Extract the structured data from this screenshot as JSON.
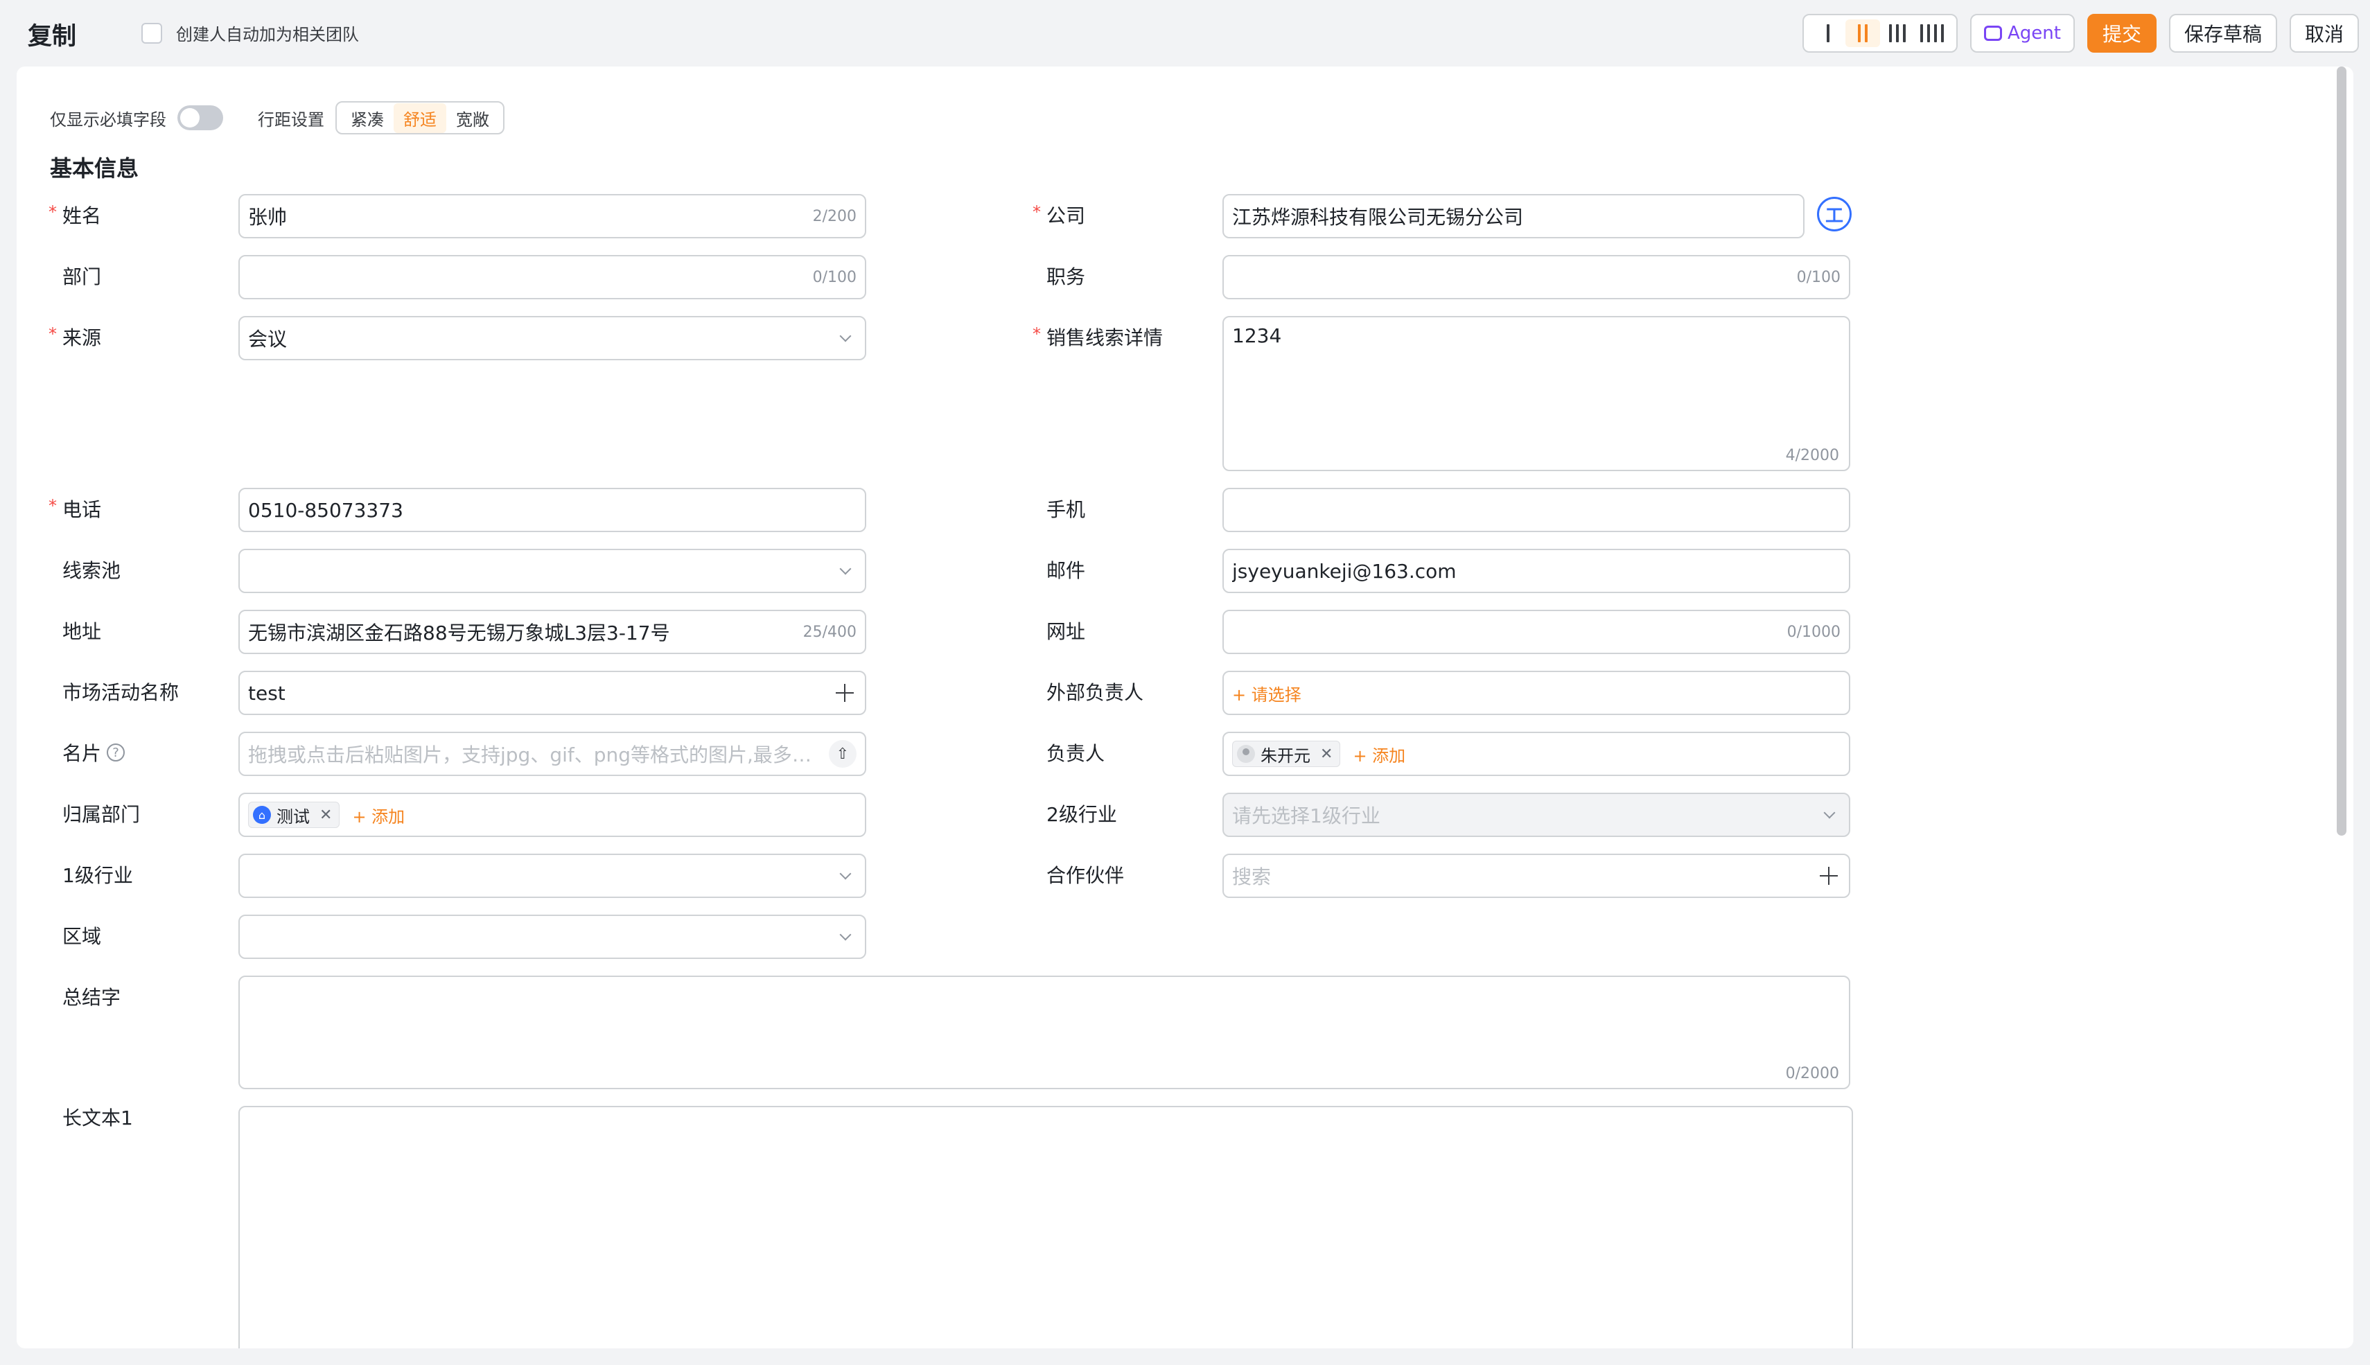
{
  "header": {
    "title": "复制",
    "auto_team_label": "创建人自动加为相关团队",
    "agent_label": "Agent",
    "submit_label": "提交",
    "save_draft_label": "保存草稿",
    "cancel_label": "取消"
  },
  "toolbar": {
    "required_only_label": "仅显示必填字段",
    "row_spacing_label": "行距设置",
    "spacing_options": [
      "紧凑",
      "舒适",
      "宽敞"
    ],
    "spacing_selected": "舒适"
  },
  "section": {
    "title": "基本信息"
  },
  "fields": {
    "name": {
      "label": "姓名",
      "value": "张帅",
      "count": "2/200"
    },
    "company": {
      "label": "公司",
      "value": "江苏烨源科技有限公司无锡分公司",
      "icon_text": "工"
    },
    "department": {
      "label": "部门",
      "value": "",
      "count": "0/100"
    },
    "position": {
      "label": "职务",
      "value": "",
      "count": "0/100"
    },
    "source": {
      "label": "来源",
      "value": "会议"
    },
    "lead_detail": {
      "label": "销售线索详情",
      "value": "1234",
      "count": "4/2000"
    },
    "phone": {
      "label": "电话",
      "value": "0510-85073373"
    },
    "mobile": {
      "label": "手机",
      "value": ""
    },
    "lead_pool": {
      "label": "线索池",
      "value": ""
    },
    "email": {
      "label": "邮件",
      "value": "jsyeyuankeji@163.com"
    },
    "address": {
      "label": "地址",
      "value": "无锡市滨湖区金石路88号无锡万象城L3层3-17号",
      "count": "25/400"
    },
    "website": {
      "label": "网址",
      "value": "",
      "count": "0/1000"
    },
    "campaign": {
      "label": "市场活动名称",
      "value": "test"
    },
    "external_owner": {
      "label": "外部负责人",
      "action": "+ 请选择"
    },
    "card": {
      "label": "名片",
      "placeholder": "拖拽或点击后粘贴图片，支持jpg、gif、png等格式的图片,最多可..."
    },
    "owner": {
      "label": "负责人",
      "tag": "朱开元",
      "add": "+ 添加"
    },
    "owner_dept": {
      "label": "归属部门",
      "tag": "测试",
      "add": "+ 添加"
    },
    "industry2": {
      "label": "2级行业",
      "placeholder": "请先选择1级行业"
    },
    "industry1": {
      "label": "1级行业",
      "value": ""
    },
    "partner": {
      "label": "合作伙伴",
      "placeholder": "搜索"
    },
    "region": {
      "label": "区域",
      "value": ""
    },
    "summary": {
      "label": "总结字",
      "value": "",
      "count": "0/2000"
    },
    "longtext1": {
      "label": "长文本1",
      "value": ""
    }
  },
  "colors": {
    "accent": "#f5841f",
    "required": "#f54a45",
    "link_blue": "#3370ff",
    "agent_purple": "#7a45f5"
  }
}
